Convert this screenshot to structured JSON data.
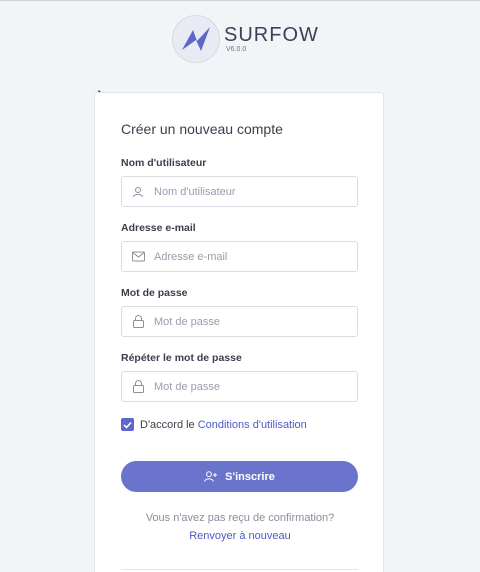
{
  "brand": {
    "name": "SURFOW",
    "version": "V6.0.0",
    "accent_color": "#5b68c9"
  },
  "form": {
    "title": "Créer un nouveau compte",
    "username": {
      "label": "Nom d'utilisateur",
      "placeholder": "Nom d'utilisateur",
      "value": "",
      "icon": "user-icon"
    },
    "email": {
      "label": "Adresse e-mail",
      "placeholder": "Adresse e-mail",
      "value": "",
      "icon": "mail-icon"
    },
    "password": {
      "label": "Mot de passe",
      "placeholder": "Mot de passe",
      "value": "",
      "icon": "lock-icon"
    },
    "password_repeat": {
      "label": "Répéter le mot de passe",
      "placeholder": "Mot de passe",
      "value": "",
      "icon": "lock-icon"
    },
    "agree": {
      "checked": true,
      "text": "D'accord le",
      "link": "Conditions d'utilisation"
    },
    "submit_label": "S'inscrire",
    "no_confirmation": "Vous n'avez pas reçu de confirmation?",
    "resend_link": "Renvoyer à nouveau"
  }
}
